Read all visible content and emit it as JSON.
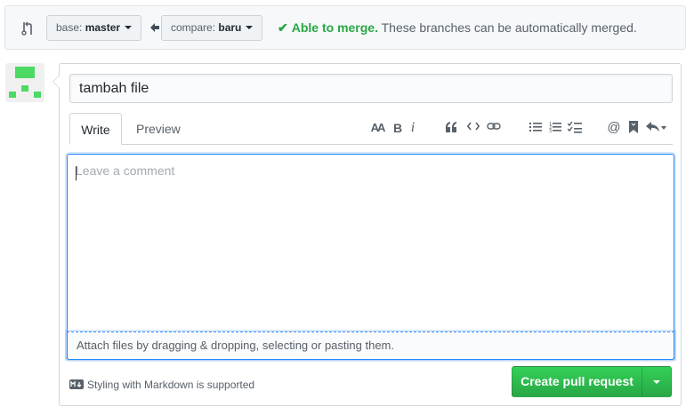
{
  "compare_bar": {
    "icon": "git-compare-icon",
    "base": {
      "prefix": "base:",
      "branch": "master"
    },
    "arrow": "arrow-left-icon",
    "compare": {
      "prefix": "compare:",
      "branch": "baru"
    },
    "merge_ok": "Able to merge.",
    "merge_msg": "These branches can be automatically merged.",
    "status_color": "#28a745"
  },
  "avatar": {
    "icon": "identicon",
    "color": "#4cd964"
  },
  "form": {
    "title_value": "tambah file",
    "tabs": [
      {
        "label": "Write",
        "active": true
      },
      {
        "label": "Preview",
        "active": false
      }
    ],
    "toolbar": {
      "header": "AA",
      "bold": "B",
      "italic": "i",
      "icons": [
        "header-icon",
        "bold-icon",
        "italic-icon",
        "quote-icon",
        "code-icon",
        "link-icon",
        "unordered-list-icon",
        "ordered-list-icon",
        "task-list-icon",
        "mention-icon",
        "bookmark-icon",
        "reply-icon"
      ]
    },
    "comment_placeholder": "Leave a comment",
    "attach_text": "Attach files by dragging & dropping, selecting or pasting them.",
    "markdown_note": "Styling with Markdown is supported",
    "submit_label": "Create pull request",
    "submit_color": "#28a745"
  }
}
